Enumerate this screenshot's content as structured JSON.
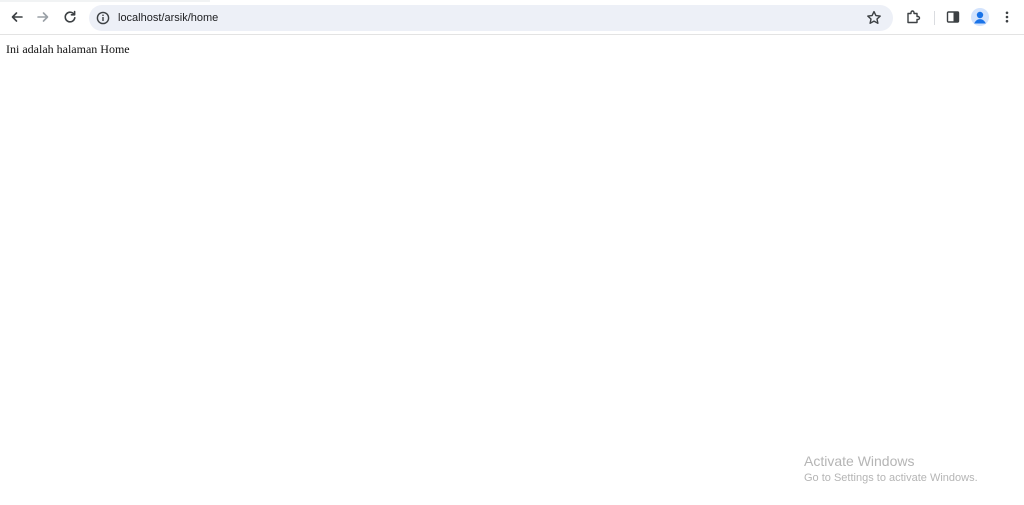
{
  "browser": {
    "address_bar": {
      "url": "localhost/arsik/home"
    },
    "icons": {
      "back": "arrow-left-icon",
      "forward": "arrow-right-icon",
      "reload": "reload-icon",
      "site_info": "info-circle-icon",
      "bookmark": "star-icon",
      "extensions": "puzzle-icon",
      "side_panel": "side-panel-icon",
      "profile": "profile-icon",
      "menu": "kebab-menu-icon"
    }
  },
  "page": {
    "body_text": "Ini adalah halaman Home"
  },
  "watermark": {
    "title": "Activate Windows",
    "subtitle": "Go to Settings to activate Windows."
  },
  "colors": {
    "omnibox_bg": "#edf0f7",
    "profile_accent": "#1a73e8"
  }
}
